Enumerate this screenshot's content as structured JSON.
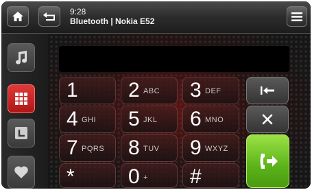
{
  "status": {
    "time": "9:28",
    "device": "Bluetooth | Nokia E52"
  },
  "topbar": {
    "home_icon": "home-icon",
    "back_icon": "back-arrow-icon",
    "menu_icon": "hamburger-menu-icon"
  },
  "sidebar": {
    "items": [
      "music-icon",
      "dialpad-icon",
      "contacts-icon",
      "favorites-icon"
    ],
    "active": "dialpad-icon"
  },
  "display": {
    "number": ""
  },
  "keypad": {
    "keys": [
      {
        "digit": "1",
        "letters": ""
      },
      {
        "digit": "2",
        "letters": "ABC"
      },
      {
        "digit": "3",
        "letters": "DEF"
      },
      {
        "digit": "4",
        "letters": "GHI"
      },
      {
        "digit": "5",
        "letters": "JKL"
      },
      {
        "digit": "6",
        "letters": "MNO"
      },
      {
        "digit": "7",
        "letters": "PQRS"
      },
      {
        "digit": "8",
        "letters": "TUV"
      },
      {
        "digit": "9",
        "letters": "WXYZ"
      },
      {
        "digit": "*",
        "letters": ""
      },
      {
        "digit": "0",
        "letters": "+"
      },
      {
        "digit": "#",
        "letters": ""
      }
    ]
  },
  "actions": {
    "backspace_icon": "backspace-icon",
    "clear_icon": "clear-x-icon",
    "call_icon": "call-icon"
  },
  "colors": {
    "accent": "#cc2222",
    "call_green": "#6cc425"
  }
}
